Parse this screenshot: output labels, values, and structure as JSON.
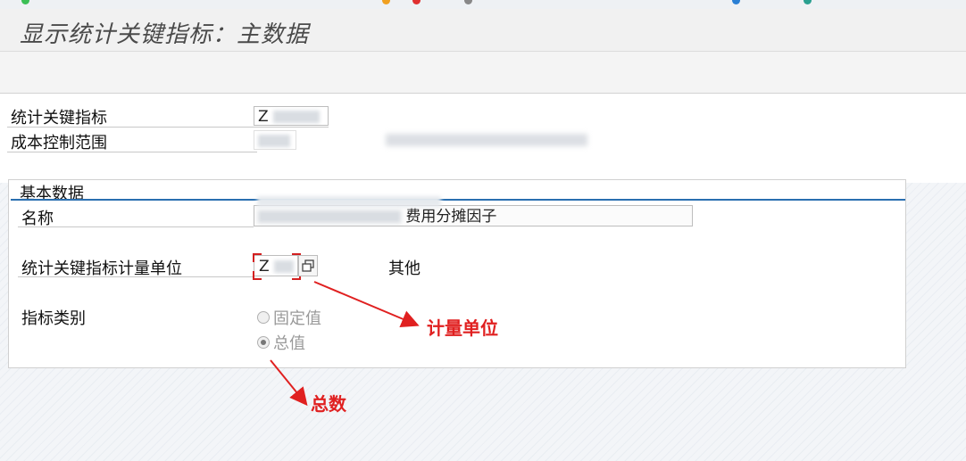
{
  "title": "显示统计关键指标：主数据",
  "header": {
    "skf_label": "统计关键指标",
    "skf_value": "Z",
    "coarea_label": "成本控制范围"
  },
  "basic": {
    "group_title": "基本数据",
    "name_label": "名称",
    "name_value_suffix": "费用分摊因子",
    "unit_label": "统计关键指标计量单位",
    "unit_value": "Z",
    "unit_desc": "其他",
    "category_label": "指标类别",
    "option_fixed": "固定值",
    "option_total": "总值",
    "selected_option": "总值"
  },
  "annotations": {
    "unit": "计量单位",
    "total": "总数"
  },
  "colors": {
    "annotation": "#e02020",
    "group_line": "#2a6fb0"
  }
}
